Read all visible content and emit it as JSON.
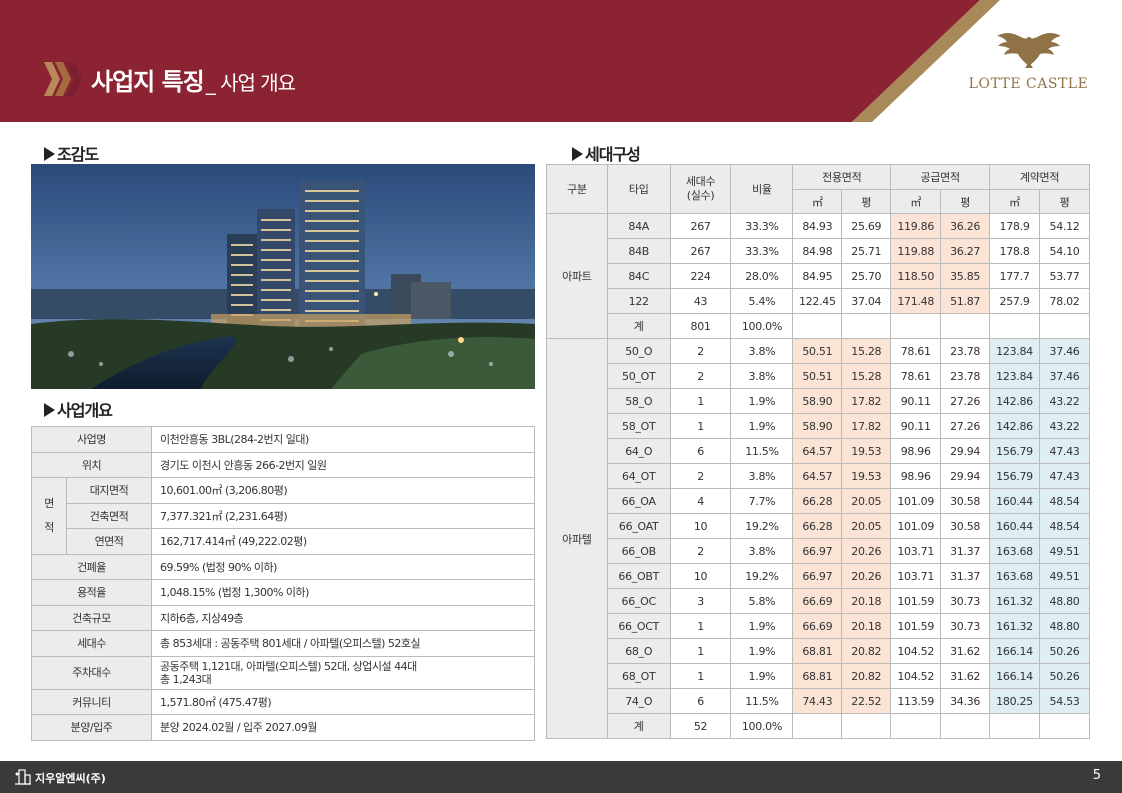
{
  "header": {
    "title": "사업지 특징",
    "subtitle": "_ 사업 개요",
    "logo_text": "LOTTE CASTLE"
  },
  "sections": {
    "aerial": "조감도",
    "overview": "사업개요",
    "units": "세대구성"
  },
  "overview": {
    "rows": [
      {
        "label": "사업명",
        "value": "이천안흥동 3BL(284-2번지 일대)"
      },
      {
        "label": "위치",
        "value": "경기도 이천시 안흥동 266-2번지 일원"
      },
      {
        "group_label_top": "면",
        "group_label_bottom": "적",
        "label": "대지면적",
        "value": "10,601.00㎡ (3,206.80평)"
      },
      {
        "label": "건축면적",
        "value": "7,377.321㎡ (2,231.64평)"
      },
      {
        "label": "연면적",
        "value": "162,717.414㎡ (49,222.02평)"
      },
      {
        "label": "건폐율",
        "value": "69.59% (법정 90% 이하)"
      },
      {
        "label": "용적율",
        "value": "1,048.15% (법정 1,300% 이하)"
      },
      {
        "label": "건축규모",
        "value": "지하6층, 지상49층"
      },
      {
        "label": "세대수",
        "value": "총 853세대 : 공동주택 801세대 / 아파텔(오피스텔) 52호실"
      },
      {
        "label": "주차대수",
        "value_line1": "공동주택 1,121대, 아파텔(오피스텔) 52대, 상업시설 44대",
        "value_line2": "총 1,243대"
      },
      {
        "label": "커뮤니티",
        "value": "1,571.80㎡ (475.47평)"
      },
      {
        "label": "분양/입주",
        "value": "분양 2024.02월 / 입주 2027.09월"
      }
    ]
  },
  "units_table": {
    "headers": {
      "category": "구분",
      "type": "타입",
      "households": "세대수\n(실수)",
      "ratio": "비율",
      "exclusive": "전용면적",
      "supply": "공급면적",
      "contract": "계약면적",
      "sqm": "㎡",
      "pyeong": "평"
    },
    "apartment": {
      "label": "아파트",
      "rows": [
        {
          "type": "84A",
          "count": "267",
          "ratio": "33.3%",
          "ex_m": "84.93",
          "ex_p": "25.69",
          "su_m": "119.86",
          "su_p": "36.26",
          "co_m": "178.9",
          "co_p": "54.12"
        },
        {
          "type": "84B",
          "count": "267",
          "ratio": "33.3%",
          "ex_m": "84.98",
          "ex_p": "25.71",
          "su_m": "119.88",
          "su_p": "36.27",
          "co_m": "178.8",
          "co_p": "54.10"
        },
        {
          "type": "84C",
          "count": "224",
          "ratio": "28.0%",
          "ex_m": "84.95",
          "ex_p": "25.70",
          "su_m": "118.50",
          "su_p": "35.85",
          "co_m": "177.7",
          "co_p": "53.77"
        },
        {
          "type": "122",
          "count": "43",
          "ratio": "5.4%",
          "ex_m": "122.45",
          "ex_p": "37.04",
          "su_m": "171.48",
          "su_p": "51.87",
          "co_m": "257.9",
          "co_p": "78.02"
        }
      ],
      "total": {
        "label": "계",
        "count": "801",
        "ratio": "100.0%"
      }
    },
    "apartel": {
      "label": "아파텔",
      "rows": [
        {
          "type": "50_O",
          "count": "2",
          "ratio": "3.8%",
          "ex_m": "50.51",
          "ex_p": "15.28",
          "su_m": "78.61",
          "su_p": "23.78",
          "co_m": "123.84",
          "co_p": "37.46"
        },
        {
          "type": "50_OT",
          "count": "2",
          "ratio": "3.8%",
          "ex_m": "50.51",
          "ex_p": "15.28",
          "su_m": "78.61",
          "su_p": "23.78",
          "co_m": "123.84",
          "co_p": "37.46"
        },
        {
          "type": "58_O",
          "count": "1",
          "ratio": "1.9%",
          "ex_m": "58.90",
          "ex_p": "17.82",
          "su_m": "90.11",
          "su_p": "27.26",
          "co_m": "142.86",
          "co_p": "43.22"
        },
        {
          "type": "58_OT",
          "count": "1",
          "ratio": "1.9%",
          "ex_m": "58.90",
          "ex_p": "17.82",
          "su_m": "90.11",
          "su_p": "27.26",
          "co_m": "142.86",
          "co_p": "43.22"
        },
        {
          "type": "64_O",
          "count": "6",
          "ratio": "11.5%",
          "ex_m": "64.57",
          "ex_p": "19.53",
          "su_m": "98.96",
          "su_p": "29.94",
          "co_m": "156.79",
          "co_p": "47.43"
        },
        {
          "type": "64_OT",
          "count": "2",
          "ratio": "3.8%",
          "ex_m": "64.57",
          "ex_p": "19.53",
          "su_m": "98.96",
          "su_p": "29.94",
          "co_m": "156.79",
          "co_p": "47.43"
        },
        {
          "type": "66_OA",
          "count": "4",
          "ratio": "7.7%",
          "ex_m": "66.28",
          "ex_p": "20.05",
          "su_m": "101.09",
          "su_p": "30.58",
          "co_m": "160.44",
          "co_p": "48.54"
        },
        {
          "type": "66_OAT",
          "count": "10",
          "ratio": "19.2%",
          "ex_m": "66.28",
          "ex_p": "20.05",
          "su_m": "101.09",
          "su_p": "30.58",
          "co_m": "160.44",
          "co_p": "48.54"
        },
        {
          "type": "66_OB",
          "count": "2",
          "ratio": "3.8%",
          "ex_m": "66.97",
          "ex_p": "20.26",
          "su_m": "103.71",
          "su_p": "31.37",
          "co_m": "163.68",
          "co_p": "49.51"
        },
        {
          "type": "66_OBT",
          "count": "10",
          "ratio": "19.2%",
          "ex_m": "66.97",
          "ex_p": "20.26",
          "su_m": "103.71",
          "su_p": "31.37",
          "co_m": "163.68",
          "co_p": "49.51"
        },
        {
          "type": "66_OC",
          "count": "3",
          "ratio": "5.8%",
          "ex_m": "66.69",
          "ex_p": "20.18",
          "su_m": "101.59",
          "su_p": "30.73",
          "co_m": "161.32",
          "co_p": "48.80"
        },
        {
          "type": "66_OCT",
          "count": "1",
          "ratio": "1.9%",
          "ex_m": "66.69",
          "ex_p": "20.18",
          "su_m": "101.59",
          "su_p": "30.73",
          "co_m": "161.32",
          "co_p": "48.80"
        },
        {
          "type": "68_O",
          "count": "1",
          "ratio": "1.9%",
          "ex_m": "68.81",
          "ex_p": "20.82",
          "su_m": "104.52",
          "su_p": "31.62",
          "co_m": "166.14",
          "co_p": "50.26"
        },
        {
          "type": "68_OT",
          "count": "1",
          "ratio": "1.9%",
          "ex_m": "68.81",
          "ex_p": "20.82",
          "su_m": "104.52",
          "su_p": "31.62",
          "co_m": "166.14",
          "co_p": "50.26"
        },
        {
          "type": "74_O",
          "count": "6",
          "ratio": "11.5%",
          "ex_m": "74.43",
          "ex_p": "22.52",
          "su_m": "113.59",
          "su_p": "34.36",
          "co_m": "180.25",
          "co_p": "54.53"
        }
      ],
      "total": {
        "label": "계",
        "count": "52",
        "ratio": "100.0%"
      }
    }
  },
  "footer": {
    "company": "지우알엔씨(주)",
    "page": "5"
  },
  "colors": {
    "header_red": "#8b2332",
    "header_gold": "#a88a5a",
    "highlight_peach": "#fbe4d6",
    "highlight_blue": "#deeef3",
    "footer_bg": "#3a3a3a"
  },
  "icons": [
    "chevron-arrows-icon",
    "eagle-logo-icon",
    "building-logo-icon"
  ]
}
